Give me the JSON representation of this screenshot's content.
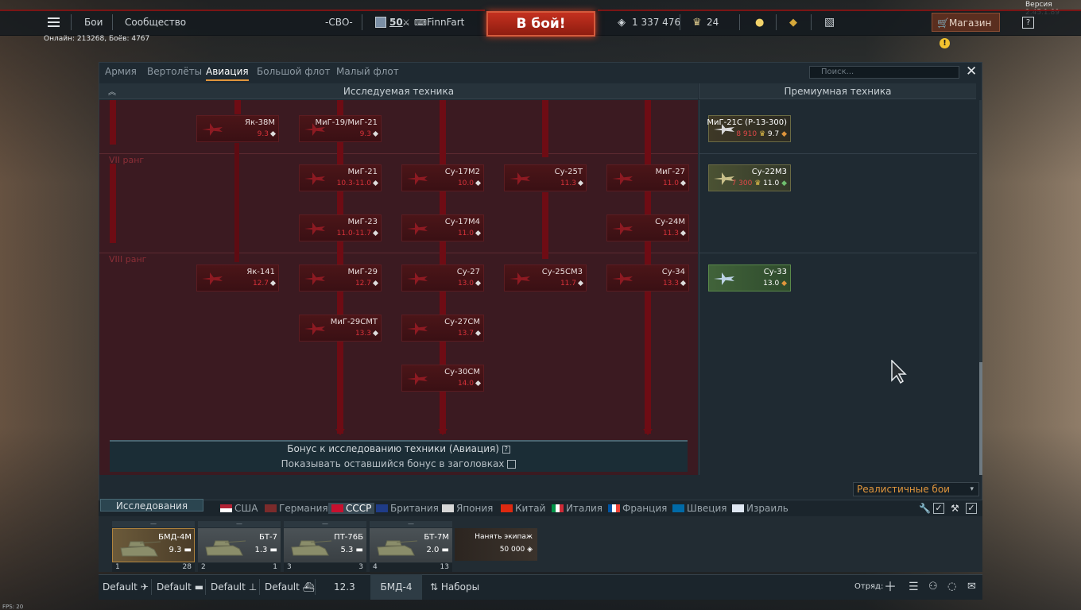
{
  "version": "Версия 2.45.1.89",
  "online": "Онлайн: 213268, Боёв: 4767",
  "fps": "FPS: 20",
  "topbar": {
    "battles": "Бои",
    "community": "Сообщество",
    "squadron": "-СВО-",
    "level": "50",
    "nickname": "FinnFart",
    "to_battle": "В бой!",
    "silver": "1 337 476",
    "gold": "24",
    "shop": "Магазин",
    "help": "?"
  },
  "tabs": [
    "Армия",
    "Вертолёты",
    "Авиация",
    "Большой флот",
    "Малый флот"
  ],
  "search_placeholder": "Поиск...",
  "headers": {
    "research": "Исследуемая техника",
    "premium": "Премиумная техника"
  },
  "ranks": [
    "VII ранг",
    "VIII ранг"
  ],
  "tree": [
    {
      "name": "Як-38М",
      "br": "9.3"
    },
    {
      "name": "МиГ-19/МиГ-21",
      "br": "9.3"
    },
    {
      "name": "МиГ-21",
      "br": "10.3-11.0"
    },
    {
      "name": "Су-17М2",
      "br": "10.0"
    },
    {
      "name": "Су-25Т",
      "br": "11.3"
    },
    {
      "name": "МиГ-27",
      "br": "11.0"
    },
    {
      "name": "МиГ-23",
      "br": "11.0-11.7"
    },
    {
      "name": "Су-17М4",
      "br": "11.0"
    },
    {
      "name": "Су-24М",
      "br": "11.3"
    },
    {
      "name": "Як-141",
      "br": "12.7"
    },
    {
      "name": "МиГ-29",
      "br": "12.7"
    },
    {
      "name": "Су-27",
      "br": "13.0"
    },
    {
      "name": "Су-25СМ3",
      "br": "11.7"
    },
    {
      "name": "Су-34",
      "br": "13.3"
    },
    {
      "name": "МиГ-29СМТ",
      "br": "13.3"
    },
    {
      "name": "Су-27СМ",
      "br": "13.7"
    },
    {
      "name": "Су-30СМ",
      "br": "14.0"
    }
  ],
  "premium": [
    {
      "name": "МиГ-21С (Р-13-300)",
      "price": "8 910",
      "br": "9.7"
    },
    {
      "name": "Су-22М3",
      "price": "7 300",
      "br": "11.0"
    },
    {
      "name": "Су-33",
      "price": "",
      "br": "13.0"
    }
  ],
  "bonus": {
    "line1": "Бонус к исследованию техники (Авиация)",
    "line2": "Показывать оставшийся бонус в заголовках"
  },
  "mode": "Реалистичные бои",
  "research_btn": "Исследования",
  "nations": [
    "США",
    "Германия",
    "СССР",
    "Британия",
    "Япония",
    "Китай",
    "Италия",
    "Франция",
    "Швеция",
    "Израиль"
  ],
  "crew": [
    {
      "name": "БМД-4М",
      "br": "9.3",
      "num": "1",
      "right": "28"
    },
    {
      "name": "БТ-7",
      "br": "1.3",
      "num": "2",
      "right": "1"
    },
    {
      "name": "ПТ-76Б",
      "br": "5.3",
      "num": "3",
      "right": "3"
    },
    {
      "name": "БТ-7М",
      "br": "2.0",
      "num": "4",
      "right": "13"
    }
  ],
  "hire": {
    "label": "Нанять экипаж",
    "cost": "50 000"
  },
  "bottom": {
    "p1": "Default",
    "p2": "Default",
    "p3": "Default",
    "p4": "Default",
    "br": "12.3",
    "preset": "БМД-4",
    "sets": "Наборы",
    "squad": "Отряд:"
  },
  "colors": {
    "accent": "#e0953c",
    "battle": "#c4301f",
    "tree_bg": "#3b1a21",
    "line": "#6e0c14"
  }
}
